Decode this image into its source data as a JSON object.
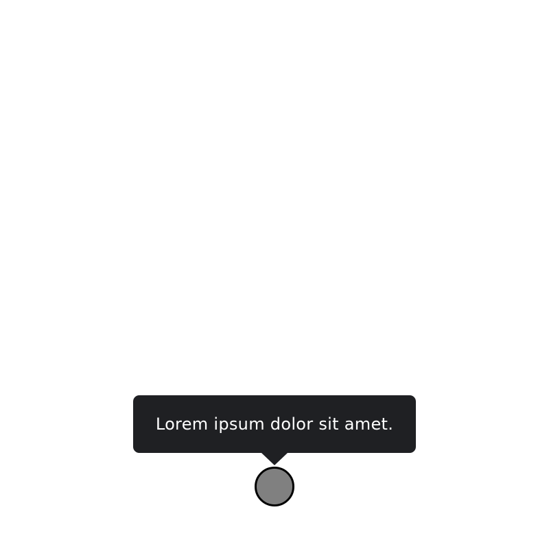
{
  "tooltip": {
    "text": "Lorem ipsum dolor sit amet.",
    "background_color": "#1f2023",
    "text_color": "#ffffff"
  },
  "anchor": {
    "fill_color": "#808080",
    "border_color": "#000000"
  }
}
